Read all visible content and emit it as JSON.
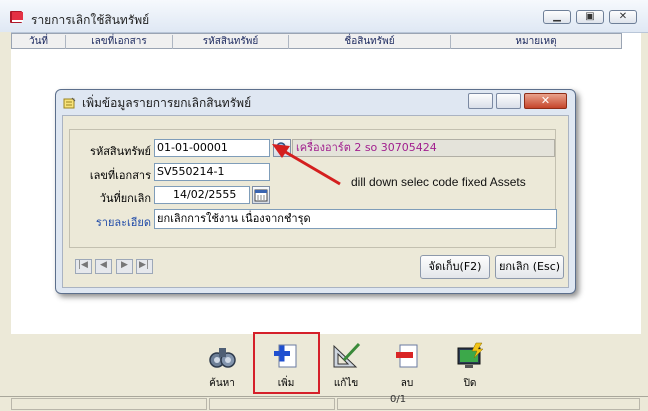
{
  "window": {
    "title": "รายการเลิกใช้สินทรัพย์"
  },
  "grid": {
    "columns": [
      "วันที่",
      "เลขที่เอกสาร",
      "รหัสสินทรัพย์",
      "ชื่อสินทรัพย์",
      "หมายเหตุ"
    ]
  },
  "dialog": {
    "title": "เพิ่มข้อมูลรายการยกเลิกสินทรัพย์",
    "asset_code_label": "รหัสสินทรัพย์",
    "asset_code_value": "01-01-00001",
    "asset_name_value": "เครื่องอาร์ต 2 so 30705424",
    "doc_no_label": "เลขที่เอกสาร",
    "doc_no_value": "SV550214-1",
    "cancel_date_label": "วันที่ยกเลิก",
    "cancel_date_value": "14/02/2555",
    "detail_label": "รายละเอียด",
    "detail_value": "ยกเลิกการใช้งาน เนื่องจากชำรุด",
    "save_button": "จัดเก็บ(F2)",
    "cancel_button": "ยกเลิก (Esc)"
  },
  "annotation": {
    "text": "dill down  selec code fixed Assets"
  },
  "toolbar": {
    "search": "ค้นหา",
    "add": "เพิ่ม",
    "edit": "แก้ไข",
    "delete": "ลบ",
    "close": "ปิด"
  },
  "status": {
    "page": "0/1"
  },
  "colors": {
    "highlight": "#d5202a",
    "asset_name": "#a11f8e",
    "label_blue": "#1f4aa8"
  }
}
